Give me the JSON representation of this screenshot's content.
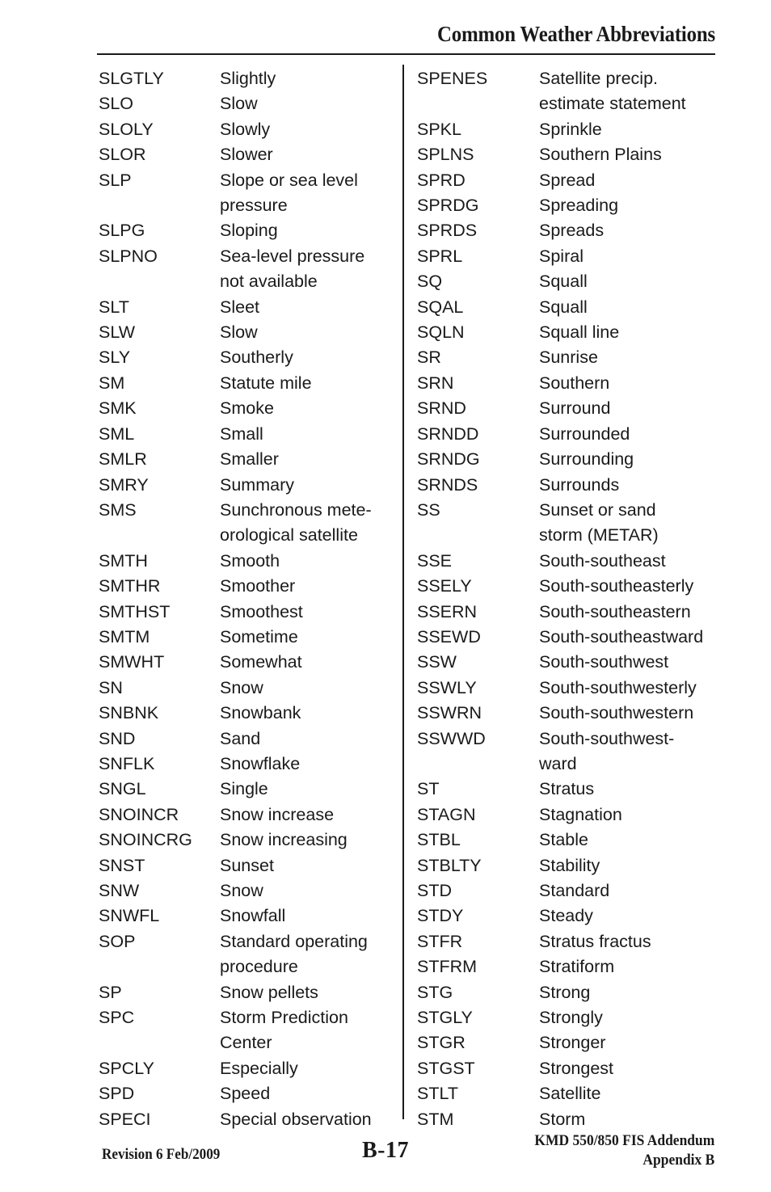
{
  "header": {
    "title": "Common Weather Abbreviations"
  },
  "glossary": {
    "left_column": [
      {
        "term": "SLGTLY",
        "definition": "Slightly"
      },
      {
        "term": "SLO",
        "definition": "Slow"
      },
      {
        "term": "SLOLY",
        "definition": "Slowly"
      },
      {
        "term": "SLOR",
        "definition": "Slower"
      },
      {
        "term": "SLP",
        "definition": "Slope or sea level\npressure"
      },
      {
        "term": "SLPG",
        "definition": "Sloping"
      },
      {
        "term": "SLPNO",
        "definition": "Sea-level pressure\nnot available"
      },
      {
        "term": "SLT",
        "definition": "Sleet"
      },
      {
        "term": "SLW",
        "definition": "Slow"
      },
      {
        "term": "SLY",
        "definition": "Southerly"
      },
      {
        "term": "SM",
        "definition": "Statute mile"
      },
      {
        "term": "SMK",
        "definition": "Smoke"
      },
      {
        "term": "SML",
        "definition": "Small"
      },
      {
        "term": "SMLR",
        "definition": "Smaller"
      },
      {
        "term": "SMRY",
        "definition": "Summary"
      },
      {
        "term": "SMS",
        "definition": "Sunchronous mete-\norological satellite"
      },
      {
        "term": "SMTH",
        "definition": "Smooth"
      },
      {
        "term": "SMTHR",
        "definition": "Smoother"
      },
      {
        "term": "SMTHST",
        "definition": "Smoothest"
      },
      {
        "term": "SMTM",
        "definition": "Sometime"
      },
      {
        "term": "SMWHT",
        "definition": "Somewhat"
      },
      {
        "term": "SN",
        "definition": "Snow"
      },
      {
        "term": "SNBNK",
        "definition": "Snowbank"
      },
      {
        "term": "SND",
        "definition": "Sand"
      },
      {
        "term": "SNFLK",
        "definition": "Snowflake"
      },
      {
        "term": "SNGL",
        "definition": "Single"
      },
      {
        "term": "SNOINCR",
        "definition": "Snow increase"
      },
      {
        "term": "SNOINCRG",
        "definition": "Snow increasing"
      },
      {
        "term": "SNST",
        "definition": "Sunset"
      },
      {
        "term": "SNW",
        "definition": "Snow"
      },
      {
        "term": "SNWFL",
        "definition": "Snowfall"
      },
      {
        "term": "SOP",
        "definition": "Standard operating\nprocedure"
      },
      {
        "term": "SP",
        "definition": "Snow pellets"
      },
      {
        "term": "SPC",
        "definition": "Storm Prediction\nCenter"
      },
      {
        "term": "SPCLY",
        "definition": "Especially"
      },
      {
        "term": "SPD",
        "definition": "Speed"
      },
      {
        "term": "SPECI",
        "definition": "Special observation"
      }
    ],
    "right_column": [
      {
        "term": "SPENES",
        "definition": "Satellite precip.\n estimate statement"
      },
      {
        "term": "SPKL",
        "definition": "Sprinkle"
      },
      {
        "term": "SPLNS",
        "definition": "Southern Plains"
      },
      {
        "term": "SPRD",
        "definition": "Spread"
      },
      {
        "term": "SPRDG",
        "definition": "Spreading"
      },
      {
        "term": "SPRDS",
        "definition": "Spreads"
      },
      {
        "term": "SPRL",
        "definition": "Spiral"
      },
      {
        "term": "SQ",
        "definition": "Squall"
      },
      {
        "term": "SQAL",
        "definition": "Squall"
      },
      {
        "term": "SQLN",
        "definition": "Squall line"
      },
      {
        "term": "SR",
        "definition": "Sunrise"
      },
      {
        "term": "SRN",
        "definition": "Southern"
      },
      {
        "term": "SRND",
        "definition": "Surround"
      },
      {
        "term": "SRNDD",
        "definition": "Surrounded"
      },
      {
        "term": "SRNDG",
        "definition": "Surrounding"
      },
      {
        "term": "SRNDS",
        "definition": "Surrounds"
      },
      {
        "term": "SS",
        "definition": "Sunset or sand\nstorm (METAR)"
      },
      {
        "term": "SSE",
        "definition": "South-southeast"
      },
      {
        "term": "SSELY",
        "definition": "South-southeasterly"
      },
      {
        "term": "SSERN",
        "definition": "South-southeastern"
      },
      {
        "term": "SSEWD",
        "definition": "South-southeastward"
      },
      {
        "term": "SSW",
        "definition": "South-southwest"
      },
      {
        "term": "SSWLY",
        "definition": "South-southwesterly"
      },
      {
        "term": "SSWRN",
        "definition": "South-southwestern"
      },
      {
        "term": "SSWWD",
        "definition": "South-southwest-\nward"
      },
      {
        "term": "ST",
        "definition": "Stratus"
      },
      {
        "term": "STAGN",
        "definition": "Stagnation"
      },
      {
        "term": "STBL",
        "definition": "Stable"
      },
      {
        "term": "STBLTY",
        "definition": "Stability"
      },
      {
        "term": "STD",
        "definition": "Standard"
      },
      {
        "term": "STDY",
        "definition": "Steady"
      },
      {
        "term": "STFR",
        "definition": "Stratus fractus"
      },
      {
        "term": "STFRM",
        "definition": "Stratiform"
      },
      {
        "term": "STG",
        "definition": "Strong"
      },
      {
        "term": "STGLY",
        "definition": "Strongly"
      },
      {
        "term": "STGR",
        "definition": "Stronger"
      },
      {
        "term": "STGST",
        "definition": "Strongest"
      },
      {
        "term": "STLT",
        "definition": "Satellite"
      },
      {
        "term": "STM",
        "definition": "Storm"
      }
    ]
  },
  "footer": {
    "revision": "Revision 6  Feb/2009",
    "page_number": "B-17",
    "document_line_1": "KMD 550/850 FIS Addendum",
    "document_line_2": "Appendix B"
  }
}
